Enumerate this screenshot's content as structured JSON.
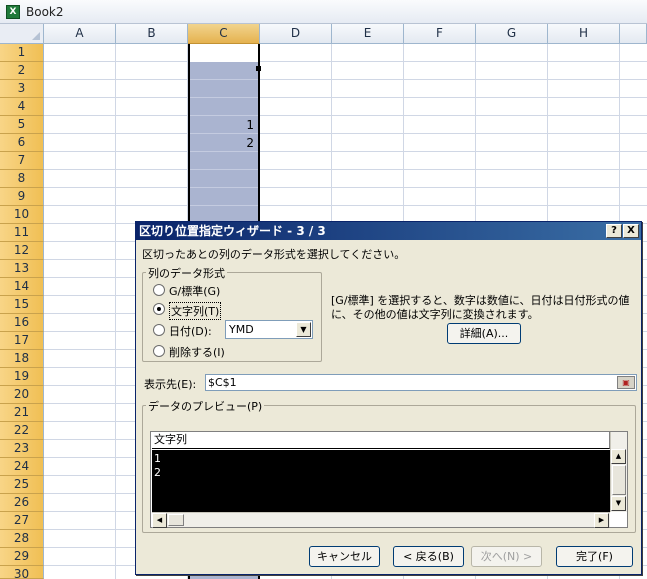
{
  "window": {
    "title": "Book2",
    "icon": "excel-icon"
  },
  "sheet": {
    "columns": [
      "A",
      "B",
      "C",
      "D",
      "E",
      "F",
      "G",
      "H"
    ],
    "selected_column": "C",
    "rows": [
      "1",
      "2",
      "3",
      "4",
      "5",
      "6",
      "7",
      "8",
      "9",
      "10",
      "11",
      "12",
      "13",
      "14",
      "15",
      "16",
      "17",
      "18",
      "19",
      "20",
      "21",
      "22",
      "23",
      "24",
      "25",
      "26",
      "27",
      "28",
      "29",
      "30"
    ],
    "cells": [
      {
        "ref": "C5",
        "value": "1"
      },
      {
        "ref": "C6",
        "value": "2"
      }
    ]
  },
  "dialog": {
    "title": "区切り位置指定ウィザード - 3 / 3",
    "help_label": "?",
    "close_label": "X",
    "instruction": "区切ったあとの列のデータ形式を選択してください。",
    "format_group": {
      "title": "列のデータ形式",
      "options": [
        {
          "label": "G/標準(G)",
          "selected": false
        },
        {
          "label": "文字列(T)",
          "selected": true
        },
        {
          "label": "日付(D):",
          "selected": false
        },
        {
          "label": "削除する(I)",
          "selected": false
        }
      ],
      "date_format": {
        "value": "YMD"
      }
    },
    "description_line1": "[G/標準] を選択すると、数字は数値に、日付は日付形式の値",
    "description_line2": "に、その他の値は文字列に変換されます。",
    "advanced_button": "詳細(A)...",
    "destination": {
      "label": "表示先(E):",
      "value": "$C$1"
    },
    "preview": {
      "title": "データのプレビュー(P)",
      "header": "文字列",
      "lines": [
        "1",
        "2"
      ]
    },
    "buttons": {
      "cancel": "キャンセル",
      "back": "< 戻る(B)",
      "next": "次へ(N) >",
      "finish": "完了(F)"
    }
  }
}
